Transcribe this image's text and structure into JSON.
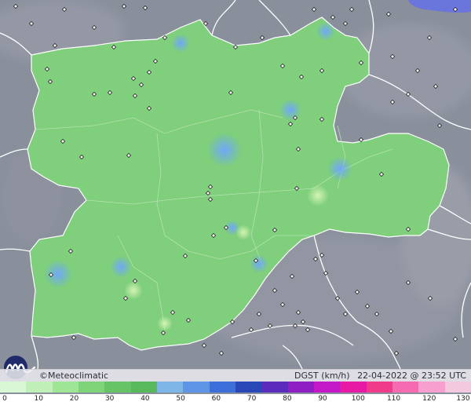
{
  "footer": {
    "brand": "Meteoclimatic",
    "copyright_symbol": "©",
    "variable": "DGST (km/h)",
    "timestamp": "22-04-2022 @ 23:52 UTC"
  },
  "legend": {
    "labels": [
      "0",
      "10",
      "20",
      "30",
      "40",
      "50",
      "60",
      "70",
      "80",
      "90",
      "100",
      "110",
      "120",
      "130"
    ],
    "colors": [
      "#d9f7d4",
      "#c0f0b8",
      "#9fe596",
      "#7fd479",
      "#67c466",
      "#57b85c",
      "#7fb6e8",
      "#5f95e6",
      "#3c6fd9",
      "#2a47b8",
      "#5a2bbd",
      "#8f1fc4",
      "#c318c8",
      "#e71aa5",
      "#f03a8a",
      "#f56ab0",
      "#f7a0cf",
      "#f2c9de"
    ]
  },
  "map": {
    "land_color": "#8b909e",
    "region_color": "#7fd07c",
    "border_color": "#ffffff",
    "sea_color": "#6f7ae0"
  }
}
